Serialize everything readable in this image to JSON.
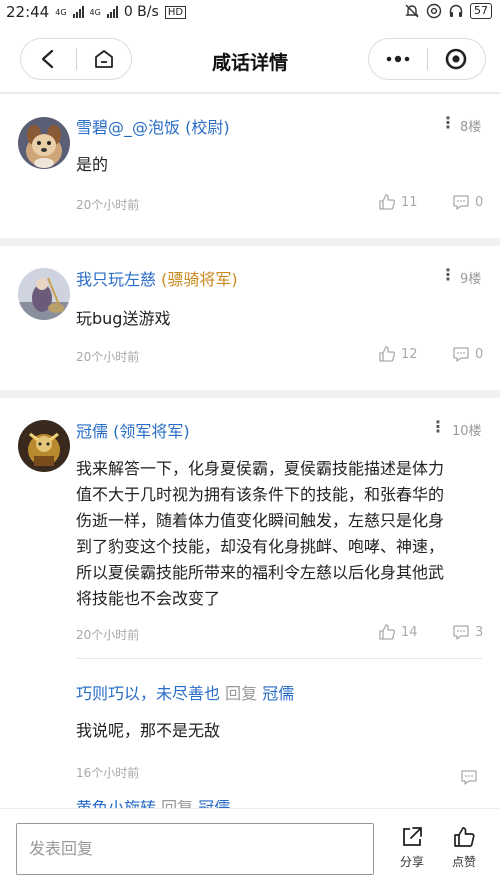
{
  "status_bar": {
    "time": "22:44",
    "net_label": "4G",
    "net_label2": "4G",
    "speed": "0 B/s",
    "hd": "HD",
    "battery": "57"
  },
  "header": {
    "title": "咸话详情",
    "back_icon": "back-chevron-icon",
    "home_icon": "home-icon",
    "more_icon": "more-dots-icon",
    "target_icon": "target-icon"
  },
  "comments": [
    {
      "username": "雪碧@_@泡饭",
      "rank": "(校尉)",
      "floor": "8楼",
      "text": "是的",
      "time": "20个小时前",
      "likes": "11",
      "replies": "0"
    },
    {
      "username": "我只玩左慈",
      "rank": "(骠骑将军)",
      "floor": "9楼",
      "text": "玩bug送游戏",
      "time": "20个小时前",
      "likes": "12",
      "replies": "0"
    },
    {
      "username": "冠儒",
      "rank": "(领军将军)",
      "floor": "10楼",
      "text_lines": [
        "我来解答一下，化身夏侯霸，夏侯霸技能描述是体力",
        "值不大于几时视为拥有该条件下的技能，和张春华的",
        "伤逝一样，随着体力值变化瞬间触发，左慈只是化身",
        "到了豹变这个技能，却没有化身挑衅、咆哮、神速，",
        "所以夏侯霸技能所带来的福利令左慈以后化身其他武",
        "将技能也不会改变了"
      ],
      "time": "20个小时前",
      "likes": "14",
      "replies": "3"
    }
  ],
  "reply": {
    "author": "巧则巧以，未尽善也",
    "verb": "回复",
    "target": "冠儒",
    "text": "我说呢，那不是无敌",
    "time": "16个小时前"
  },
  "reply_partial": {
    "author": "黄色小旋转",
    "verb": "回复",
    "target": "冠儒"
  },
  "bottom_bar": {
    "input_placeholder": "发表回复",
    "share_label": "分享",
    "like_label": "点赞"
  }
}
